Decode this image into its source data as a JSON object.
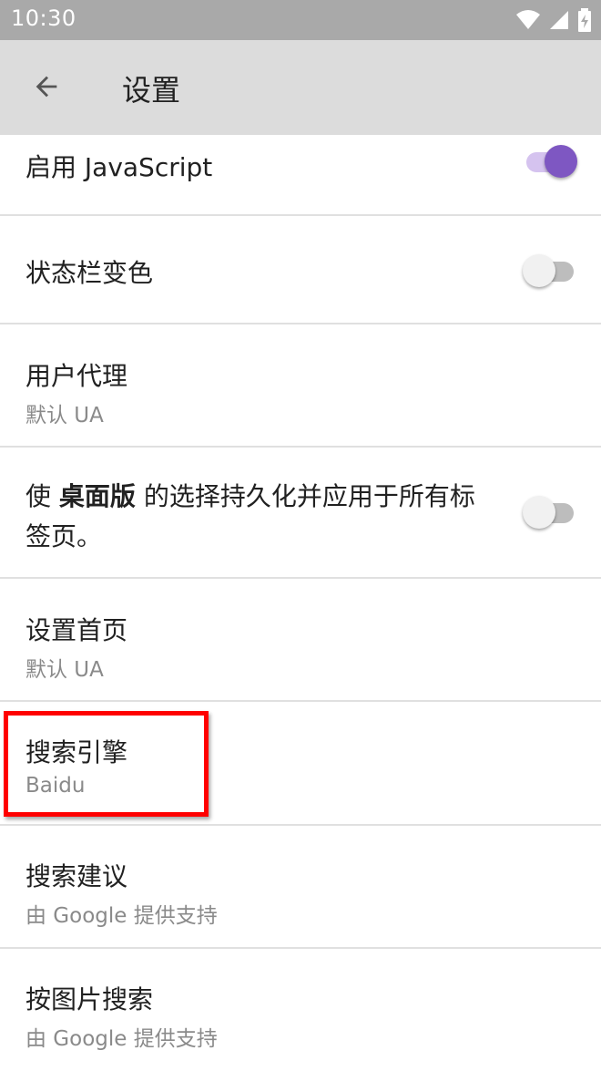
{
  "status_bar": {
    "time": "10:30",
    "icons": [
      "wifi-icon",
      "cell-signal-icon",
      "battery-charging-icon"
    ]
  },
  "app_bar": {
    "back_icon": "arrow-left-icon",
    "title": "设置"
  },
  "settings": {
    "javascript": {
      "title": "启用 JavaScript",
      "enabled": true
    },
    "status_bar_color": {
      "title": "状态栏变色",
      "enabled": false
    },
    "user_agent": {
      "title": "用户代理",
      "summary": "默认 UA"
    },
    "desktop_persist": {
      "title_prefix": "使 ",
      "title_bold": "桌面版",
      "title_suffix": " 的选择持久化并应用于所有标签页。",
      "enabled": false
    },
    "home_page": {
      "title": "设置首页",
      "summary": "默认 UA"
    },
    "search_engine": {
      "title": "搜索引擎",
      "summary": "Baidu"
    },
    "search_suggestions": {
      "title": "搜索建议",
      "summary": "由 Google 提供支持"
    },
    "image_search": {
      "title": "按图片搜索",
      "summary": "由 Google 提供支持"
    }
  },
  "colors": {
    "accent": "#7e57c2",
    "app_bar": "#dcdcdc",
    "status_bar": "#a9a9a9",
    "highlight": "#ff0000"
  }
}
